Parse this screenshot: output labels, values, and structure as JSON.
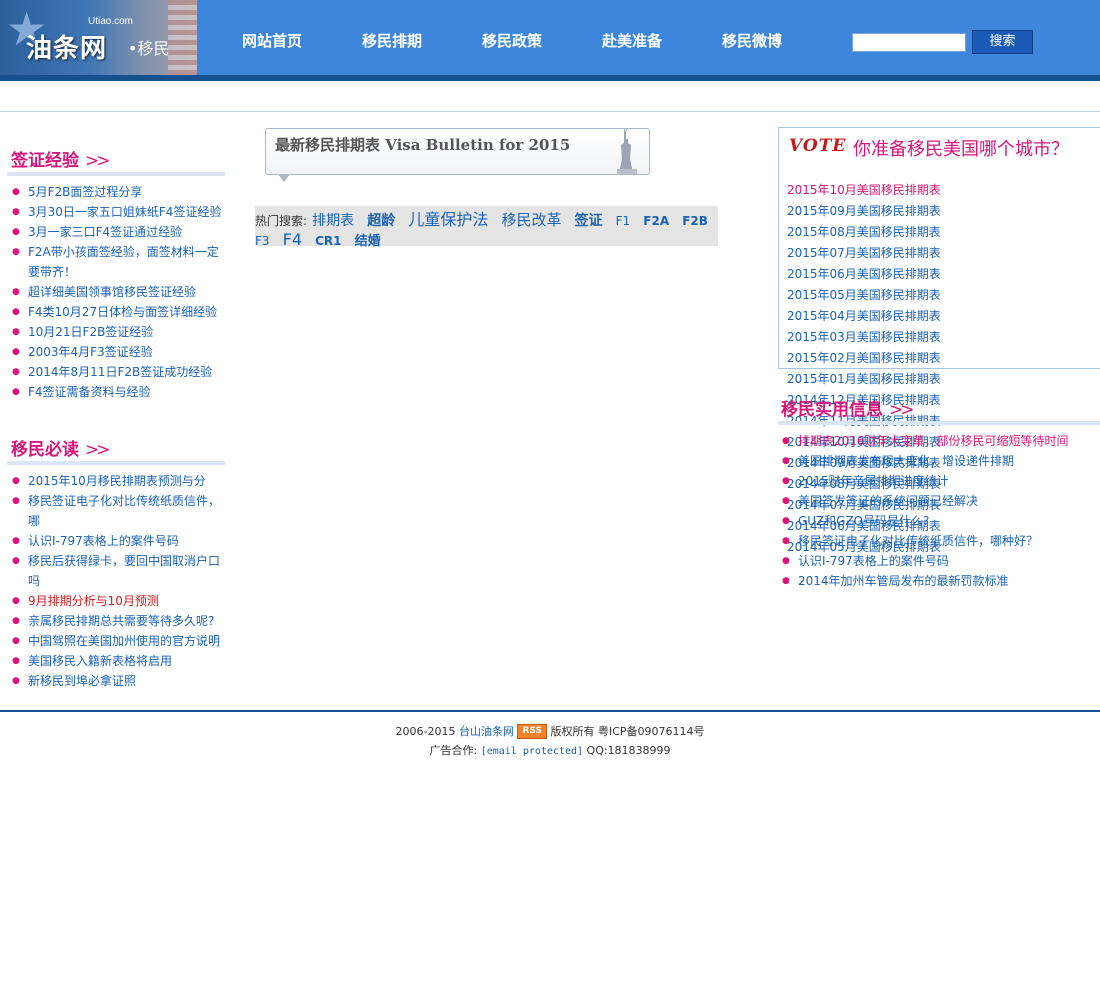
{
  "logo": {
    "domain": "Utiao.com",
    "name": "油条网",
    "dot": "•",
    "sub": "移民"
  },
  "nav": [
    "网站首页",
    "移民排期",
    "移民政策",
    "赴美准备",
    "移民微博"
  ],
  "search": {
    "button": "搜索",
    "placeholder": ""
  },
  "left_sections": [
    {
      "title": "签证经验",
      "items": [
        {
          "text": "5月F2B面签过程分享"
        },
        {
          "text": "3月30日一家五口姐妹纸F4签证经验"
        },
        {
          "text": "3月一家三口F4签证通过经验"
        },
        {
          "text": "F2A带小孩面签经验，面签材料一定要带齐！"
        },
        {
          "text": "超详细美国领事馆移民签证经验"
        },
        {
          "text": "F4类10月27日体检与面签详细经验"
        },
        {
          "text": "10月21日F2B签证经验"
        },
        {
          "text": "2003年4月F3签证经验"
        },
        {
          "text": "2014年8月11日F2B签证成功经验"
        },
        {
          "text": "F4签证需备资料与经验"
        }
      ]
    },
    {
      "title": "移民必读",
      "items": [
        {
          "text": "2015年10月移民排期表预测与分"
        },
        {
          "text": "移民签证电子化对比传统纸质信件，哪"
        },
        {
          "text": "认识I-797表格上的案件号码"
        },
        {
          "text": "移民后获得绿卡，要回中国取消户口吗"
        },
        {
          "text": "9月排期分析与10月预测",
          "red": true
        },
        {
          "text": "亲属移民排期总共需要等待多久呢?"
        },
        {
          "text": "中国驾照在美国加州使用的官方说明"
        },
        {
          "text": "美国移民入籍新表格将启用"
        },
        {
          "text": "新移民到埠必拿证照"
        }
      ]
    }
  ],
  "bulletin": {
    "title": "最新移民排期表 Visa Bulletin for 2015"
  },
  "hot_search": {
    "label": "热门搜索:",
    "tags": [
      {
        "text": "排期表",
        "size": 14,
        "bold": false
      },
      {
        "text": "超龄",
        "size": 14,
        "bold": true
      },
      {
        "text": "儿童保护法",
        "size": 16,
        "bold": false
      },
      {
        "text": "移民改革",
        "size": 15,
        "bold": false
      },
      {
        "text": "签证",
        "size": 14,
        "bold": true
      },
      {
        "text": "F1",
        "size": 12,
        "bold": false
      },
      {
        "text": "F2A",
        "size": 12,
        "bold": true
      },
      {
        "text": "F2B",
        "size": 12,
        "bold": true
      },
      {
        "text": "F3",
        "size": 12,
        "bold": false
      },
      {
        "text": "F4",
        "size": 16,
        "bold": false
      },
      {
        "text": "CR1",
        "size": 12,
        "bold": true
      },
      {
        "text": "结婚",
        "size": 13,
        "bold": true
      }
    ]
  },
  "vote": {
    "badge": "VOTE",
    "title": "你准备移民美国哪个城市？",
    "links": [
      {
        "text": "2015年10月美国移民排期表",
        "highlight": true
      },
      {
        "text": "2015年09月美国移民排期表"
      },
      {
        "text": "2015年08月美国移民排期表"
      },
      {
        "text": "2015年07月美国移民排期表"
      },
      {
        "text": "2015年06月美国移民排期表"
      },
      {
        "text": "2015年05月美国移民排期表"
      },
      {
        "text": "2015年04月美国移民排期表"
      },
      {
        "text": "2015年03月美国移民排期表"
      },
      {
        "text": "2015年02月美国移民排期表"
      },
      {
        "text": "2015年01月美国移民排期表"
      },
      {
        "text": "2014年12月美国移民排期表"
      },
      {
        "text": "2014年11月美国移民排期表"
      },
      {
        "text": "2014年10月美国移民排期表"
      },
      {
        "text": "2014年09月美国移民排期表"
      },
      {
        "text": "2014年08月美国移民排期表"
      },
      {
        "text": "2014年07月美国移民排期表"
      },
      {
        "text": "2014年06月美国移民排期表"
      },
      {
        "text": "2014年05月美国移民排期表"
      }
    ]
  },
  "practical": {
    "title": "移民实用信息",
    "items": [
      {
        "text": "排期表2016财年大变革，部份移民可缩短等待时间",
        "highlight": true
      },
      {
        "text": "美国排期表发布现大变化，增设递件排期"
      },
      {
        "text": "2015财年亲属排期进度统计"
      },
      {
        "text": "美国签发签证的系统问题已经解决"
      },
      {
        "text": "GUZ和GZO号码是什么?"
      },
      {
        "text": "移民签证电子化对比传统纸质信件，哪种好？"
      },
      {
        "text": "认识I-797表格上的案件号码"
      },
      {
        "text": "2014年加州车管局发布的最新罚款标准"
      }
    ]
  },
  "footer": {
    "years": "2006-2015",
    "site_link": "台山油条网",
    "rss": "RSS",
    "rights": "版权所有",
    "icp": "粤ICP备09076114号",
    "ad_label": "广告合作:",
    "email": "[email protected]",
    "qq": "QQ:181838999"
  },
  "colors": {
    "header": "#3d86dc",
    "header_bar": "#16508f",
    "accent": "#d8157a",
    "link": "#1a62b4"
  }
}
